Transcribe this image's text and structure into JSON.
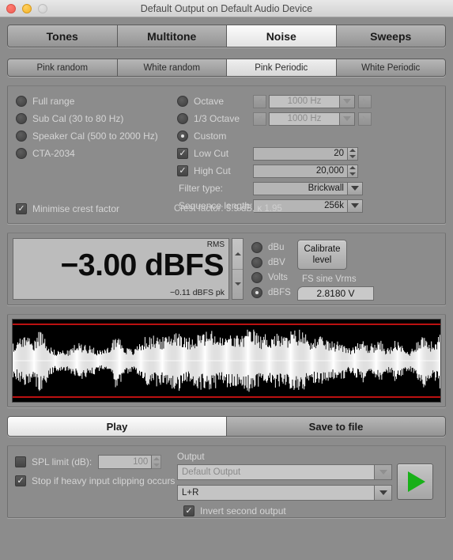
{
  "window": {
    "title": "Default Output on Default Audio Device",
    "traffic_lights": [
      "close-button",
      "minimize-button",
      "zoom-button"
    ]
  },
  "main_tabs": [
    {
      "label": "Tones",
      "active": false
    },
    {
      "label": "Multitone",
      "active": false
    },
    {
      "label": "Noise",
      "active": true
    },
    {
      "label": "Sweeps",
      "active": false
    }
  ],
  "sub_tabs": [
    {
      "label": "Pink random",
      "active": false
    },
    {
      "label": "White random",
      "active": false
    },
    {
      "label": "Pink Periodic",
      "active": true
    },
    {
      "label": "White Periodic",
      "active": false
    }
  ],
  "options": {
    "left_radios": [
      {
        "label": "Full range",
        "selected": false
      },
      {
        "label": "Sub Cal (30 to 80 Hz)",
        "selected": false
      },
      {
        "label": "Speaker Cal (500 to 2000 Hz)",
        "selected": false
      },
      {
        "label": "CTA-2034",
        "selected": false
      }
    ],
    "minimise_crest": {
      "label": "Minimise crest factor",
      "checked": true
    },
    "crest_note": "Crest factor: 5.9 dB, κ 1.95",
    "octave": {
      "label": "Octave",
      "selected": false,
      "value": "1000 Hz",
      "disabled": true
    },
    "third_octave": {
      "label": "1/3 Octave",
      "selected": false,
      "value": "1000 Hz",
      "disabled": true
    },
    "custom": {
      "label": "Custom",
      "selected": true
    },
    "low_cut": {
      "label": "Low Cut",
      "checked": true,
      "value": "20"
    },
    "high_cut": {
      "label": "High Cut",
      "checked": true,
      "value": "20,000"
    },
    "filter_type": {
      "label": "Filter type:",
      "value": "Brickwall"
    },
    "sequence_length": {
      "label": "Sequence length:",
      "value": "256k"
    }
  },
  "meter": {
    "rms_tag": "RMS",
    "readout": "−3.00 dBFS",
    "peak": "−0.11 dBFS pk",
    "units": [
      {
        "label": "dBu",
        "selected": false
      },
      {
        "label": "dBV",
        "selected": false
      },
      {
        "label": "Volts",
        "selected": false
      },
      {
        "label": "dBFS",
        "selected": true
      }
    ],
    "calibrate_button": "Calibrate\nlevel",
    "calibrate_line1": "Calibrate",
    "calibrate_line2": "level",
    "fs_sine_label": "FS sine Vrms",
    "fs_sine_value": "2.8180 V"
  },
  "waveform": {
    "description": "pink periodic noise time-domain waveform",
    "background": "#000000",
    "trace_color": "#ffffff",
    "limit_line_color": "#bb1111",
    "center_line_color": "#c8c8c8"
  },
  "play_tabs": [
    {
      "label": "Play",
      "active": true
    },
    {
      "label": "Save to file",
      "active": false
    }
  ],
  "bottom": {
    "spl_limit": {
      "label": "SPL limit (dB):",
      "checked": false,
      "value": "100",
      "disabled": true
    },
    "stop_clipping": {
      "label": "Stop if heavy input clipping occurs",
      "checked": true
    },
    "output_label": "Output",
    "output_device": {
      "value": "Default Output",
      "disabled": true
    },
    "output_channel": {
      "value": "L+R",
      "disabled": false
    },
    "invert_second": {
      "label": "Invert second output",
      "checked": true
    },
    "play_button": "play-triangle",
    "play_color": "#18b018"
  }
}
